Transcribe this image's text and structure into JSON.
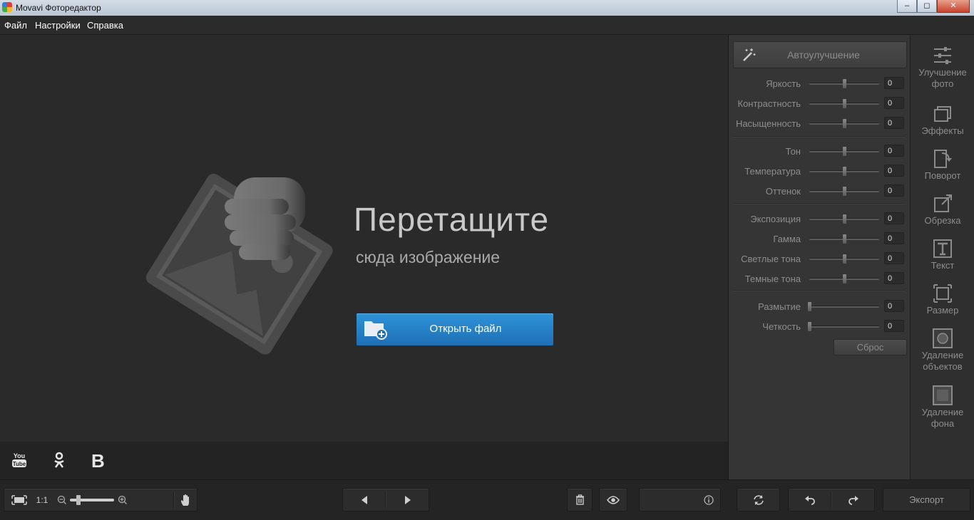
{
  "window": {
    "title": "Movavi Фоторедактор",
    "minimize": "‒",
    "maximize": "◻",
    "close": "✕"
  },
  "menu": {
    "items": [
      "Файл",
      "Настройки",
      "Справка"
    ]
  },
  "canvas": {
    "title": "Перетащите",
    "subtitle": "сюда изображение",
    "open_button": "Открыть файл"
  },
  "social": {
    "vk_letter": "B",
    "youtube_top": "You",
    "youtube_bottom": "Tube"
  },
  "adjust": {
    "auto_label": "Автоулучшение",
    "sliders": [
      {
        "label": "Яркость",
        "value": "0",
        "level": 0.5
      },
      {
        "label": "Контрастность",
        "value": "0",
        "level": 0.5
      },
      {
        "label": "Насыщенность",
        "value": "0",
        "level": 0.5
      },
      {
        "label": "Тон",
        "value": "0",
        "level": 0.5
      },
      {
        "label": "Температура",
        "value": "0",
        "level": 0.5
      },
      {
        "label": "Оттенок",
        "value": "0",
        "level": 0.5
      },
      {
        "label": "Экспозиция",
        "value": "0",
        "level": 0.5
      },
      {
        "label": "Гамма",
        "value": "0",
        "level": 0.5
      },
      {
        "label": "Светлые тона",
        "value": "0",
        "level": 0.5
      },
      {
        "label": "Темные тона",
        "value": "0",
        "level": 0.5
      },
      {
        "label": "Размытие",
        "value": "0",
        "level": 0
      },
      {
        "label": "Четкость",
        "value": "0",
        "level": 0
      }
    ],
    "reset_label": "Сброс"
  },
  "tools": [
    {
      "line1": "Улучшение",
      "line2": "фото"
    },
    {
      "line1": "Эффекты",
      "line2": ""
    },
    {
      "line1": "Поворот",
      "line2": ""
    },
    {
      "line1": "Обрезка",
      "line2": ""
    },
    {
      "line1": "Текст",
      "line2": ""
    },
    {
      "line1": "Размер",
      "line2": ""
    },
    {
      "line1": "Удаление",
      "line2": "объектов"
    },
    {
      "line1": "Удаление",
      "line2": "фона"
    }
  ],
  "bottom": {
    "zoom_ratio": "1:1",
    "zoom_level": 0.2,
    "export_label": "Экспорт"
  },
  "colors": {
    "accent": "#2586cc",
    "background": "#2a2a2a",
    "panel": "#353535"
  }
}
